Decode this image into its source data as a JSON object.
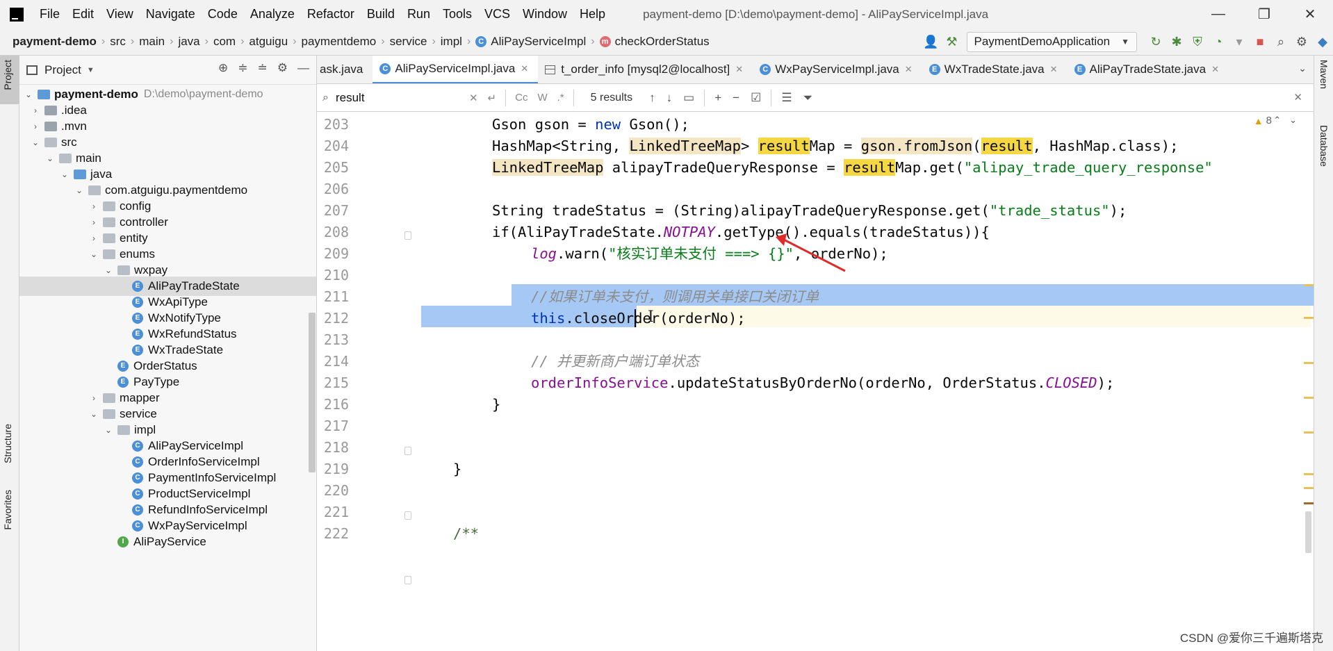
{
  "menubar": {
    "items": [
      "File",
      "Edit",
      "View",
      "Navigate",
      "Code",
      "Analyze",
      "Refactor",
      "Build",
      "Run",
      "Tools",
      "VCS",
      "Window",
      "Help"
    ],
    "window_title": "payment-demo [D:\\demo\\payment-demo] - AliPayServiceImpl.java"
  },
  "breadcrumb": [
    "payment-demo",
    "src",
    "main",
    "java",
    "com",
    "atguigu",
    "paymentdemo",
    "service",
    "impl",
    "AliPayServiceImpl",
    "checkOrderStatus"
  ],
  "run_config": "PaymentDemoApplication",
  "left_strip": {
    "project": "Project",
    "structure": "Structure",
    "favorites": "Favorites"
  },
  "right_strip": {
    "maven": "Maven",
    "database": "Database"
  },
  "project_panel": {
    "title": "Project",
    "tree": [
      {
        "label": "payment-demo",
        "hint": "D:\\demo\\payment-demo",
        "kind": "module"
      },
      {
        "label": ".idea",
        "kind": "folder"
      },
      {
        "label": ".mvn",
        "kind": "folder"
      },
      {
        "label": "src",
        "kind": "folder"
      },
      {
        "label": "main",
        "kind": "folder"
      },
      {
        "label": "java",
        "kind": "folder"
      },
      {
        "label": "com.atguigu.paymentdemo",
        "kind": "package"
      },
      {
        "label": "config",
        "kind": "package"
      },
      {
        "label": "controller",
        "kind": "package"
      },
      {
        "label": "entity",
        "kind": "package"
      },
      {
        "label": "enums",
        "kind": "package"
      },
      {
        "label": "wxpay",
        "kind": "package"
      },
      {
        "label": "AliPayTradeState",
        "kind": "enum"
      },
      {
        "label": "WxApiType",
        "kind": "enum"
      },
      {
        "label": "WxNotifyType",
        "kind": "enum"
      },
      {
        "label": "WxRefundStatus",
        "kind": "enum"
      },
      {
        "label": "WxTradeState",
        "kind": "enum"
      },
      {
        "label": "OrderStatus",
        "kind": "enum"
      },
      {
        "label": "PayType",
        "kind": "enum"
      },
      {
        "label": "mapper",
        "kind": "package"
      },
      {
        "label": "service",
        "kind": "package"
      },
      {
        "label": "impl",
        "kind": "package"
      },
      {
        "label": "AliPayServiceImpl",
        "kind": "class"
      },
      {
        "label": "OrderInfoServiceImpl",
        "kind": "class"
      },
      {
        "label": "PaymentInfoServiceImpl",
        "kind": "class"
      },
      {
        "label": "ProductServiceImpl",
        "kind": "class"
      },
      {
        "label": "RefundInfoServiceImpl",
        "kind": "class"
      },
      {
        "label": "WxPayServiceImpl",
        "kind": "class"
      },
      {
        "label": "AliPayService",
        "kind": "interface"
      }
    ]
  },
  "tabs": [
    {
      "label": "ask.java",
      "active": false
    },
    {
      "label": "AliPayServiceImpl.java",
      "active": true
    },
    {
      "label": "t_order_info [mysql2@localhost]",
      "active": false
    },
    {
      "label": "WxPayServiceImpl.java",
      "active": false
    },
    {
      "label": "WxTradeState.java",
      "active": false
    },
    {
      "label": "AliPayTradeState.java",
      "active": false
    }
  ],
  "search": {
    "value": "result",
    "results": "5 results",
    "case_label": "Cc",
    "word_label": "W"
  },
  "editor": {
    "warnings": "8",
    "line_numbers": [
      "203",
      "204",
      "205",
      "206",
      "207",
      "208",
      "209",
      "210",
      "211",
      "212",
      "213",
      "214",
      "215",
      "216",
      "217",
      "218",
      "219",
      "220",
      "221",
      "222"
    ],
    "code": {
      "l203": {
        "a": "Gson gson = ",
        "kw": "new",
        "b": " Gson();"
      },
      "l204": {
        "a": "HashMap<String, ",
        "t1": "LinkedTreeMap",
        "b": "> ",
        "r1": "result",
        "c": "Map = ",
        "t2": "gson.fromJson",
        "d": "(",
        "r2": "result",
        "e": ", HashMap.class);"
      },
      "l205": {
        "t1": "LinkedTreeMap",
        "a": " alipayTradeQueryResponse = ",
        "r1": "result",
        "b": "Map.get(",
        "s": "\"alipay_trade_query_response\""
      },
      "l207": {
        "a": "String tradeStatus = (String)alipayTradeQueryResponse.get(",
        "s": "\"trade_status\"",
        "b": ");"
      },
      "l208": {
        "a": "if(AliPayTradeState.",
        "st": "NOTPAY",
        "b": ".getType().equals(tradeStatus)){"
      },
      "l209": {
        "f": "log",
        "a": ".warn(",
        "s": "\"核实订单未支付 ===> {}\"",
        "b": ", orderNo);"
      },
      "l211": {
        "c": "//如果订单未支付，则调用关单接口关闭订单"
      },
      "l212": {
        "kw": "this",
        "a": ".closeOrder(orderNo);"
      },
      "l214": {
        "c": "// 并更新商户端订单状态"
      },
      "l215": {
        "f": "orderInfoService",
        "a": ".updateStatusByOrderNo(orderNo, OrderStatus.",
        "st": "CLOSED",
        "b": ");"
      },
      "l216": {
        "a": "}"
      },
      "l219": {
        "a": "}"
      },
      "l222": {
        "c": "/**"
      }
    }
  },
  "watermark": "CSDN @爱你三千遍斯塔克",
  "colors": {
    "accent": "#4a8fd8",
    "selection": "#a6c8f5",
    "match": "#f5d742"
  }
}
